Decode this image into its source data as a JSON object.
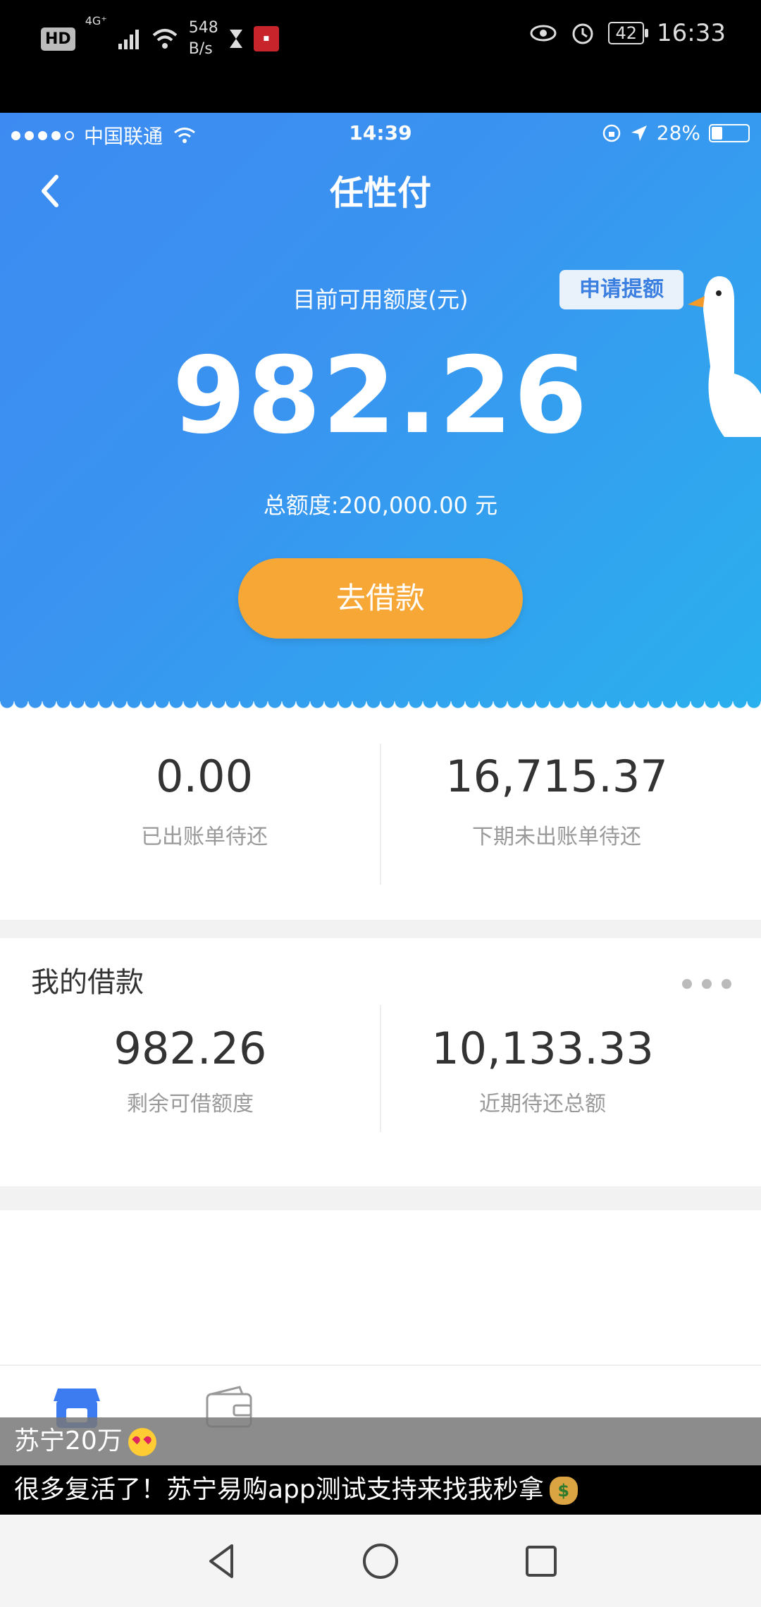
{
  "android_status": {
    "hd": "HD",
    "signal": "4G⁺",
    "net_speed_value": "548",
    "net_speed_unit": "B/s",
    "battery": "42",
    "time": "16:33"
  },
  "ios_status": {
    "carrier": "中国联通",
    "time": "14:39",
    "battery_percent": "28%"
  },
  "header": {
    "title": "任性付"
  },
  "hero": {
    "available_label": "目前可用额度(元)",
    "available_amount": "982.26",
    "total_line": "总额度:200,000.00 元",
    "borrow_button": "去借款",
    "apply_raise": "申请提额"
  },
  "summary": {
    "billed_amount": "0.00",
    "billed_label": "已出账单待还",
    "next_amount": "16,715.37",
    "next_label": "下期未出账单待还"
  },
  "loans": {
    "title": "我的借款",
    "remaining_amount": "982.26",
    "remaining_label": "剩余可借额度",
    "due_amount": "10,133.33",
    "due_label": "近期待还总额"
  },
  "captions": {
    "line1": "苏宁20万",
    "line2": "很多复活了！苏宁易购app测试支持来找我秒拿"
  },
  "colors": {
    "accent_blue": "#3d8bf2",
    "button_orange": "#f7a736"
  }
}
